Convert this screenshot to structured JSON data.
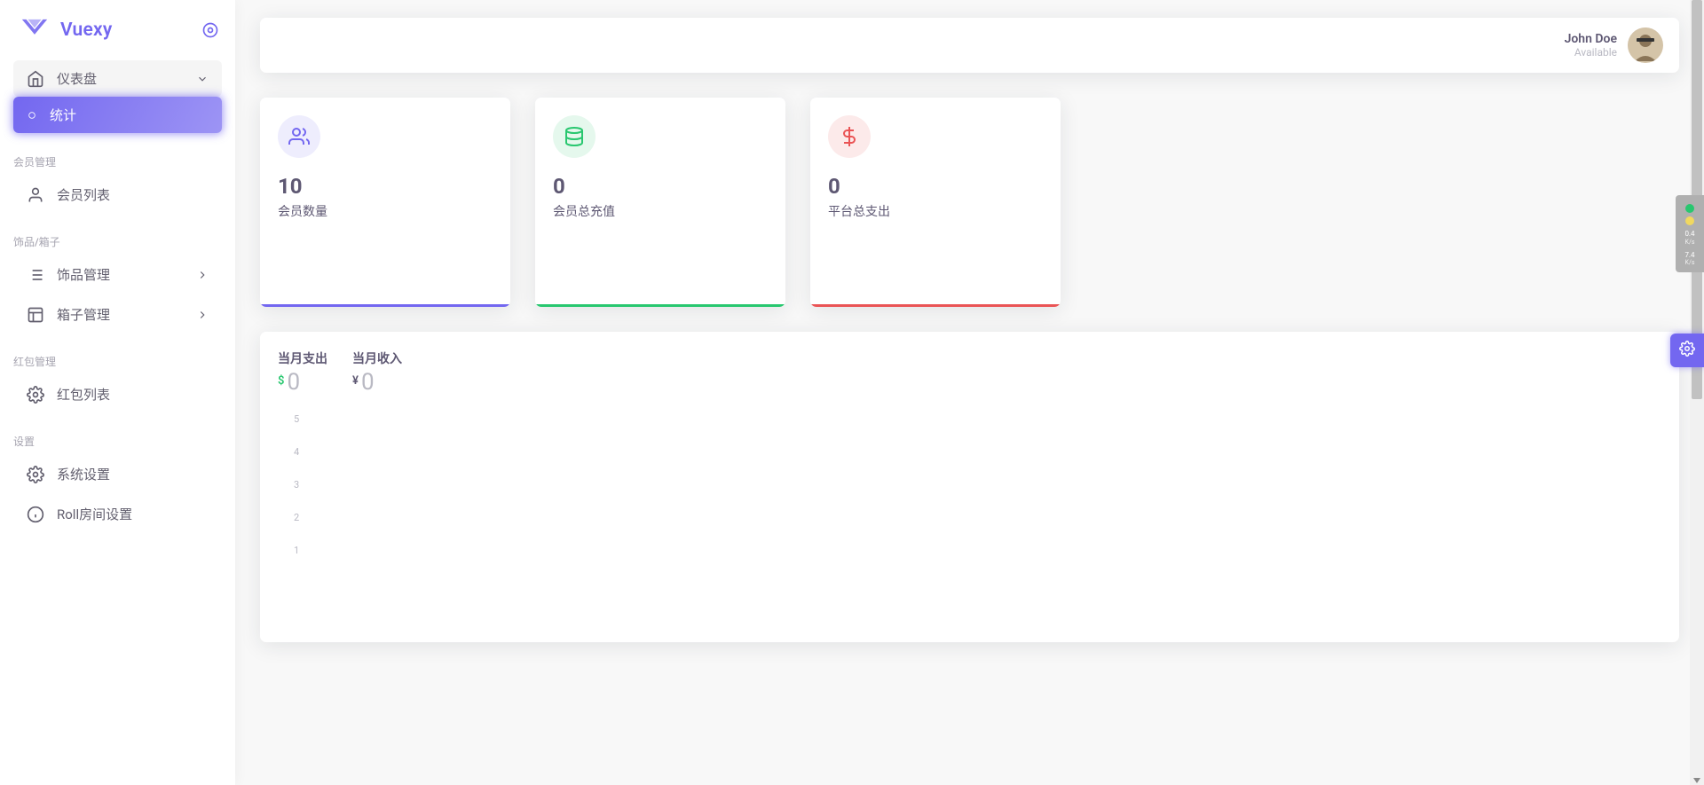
{
  "brand": {
    "name": "Vuexy"
  },
  "user": {
    "name": "John Doe",
    "status": "Available"
  },
  "sidebar": {
    "dashboard": {
      "label": "仪表盘"
    },
    "stats": {
      "label": "统计"
    },
    "sections": {
      "members": "会员管理",
      "items": "饰品/箱子",
      "redpacket": "红包管理",
      "settings": "设置"
    },
    "memberList": "会员列表",
    "itemManage": "饰品管理",
    "boxManage": "箱子管理",
    "redpacketList": "红包列表",
    "systemSettings": "系统设置",
    "rollRoomSettings": "Roll房间设置"
  },
  "stats": {
    "members": {
      "value": "10",
      "label": "会员数量"
    },
    "recharge": {
      "value": "0",
      "label": "会员总充值"
    },
    "payout": {
      "value": "0",
      "label": "平台总支出"
    }
  },
  "revenue": {
    "expenseTitle": "当月支出",
    "incomeTitle": "当月收入",
    "expenseValue": "0",
    "incomeValue": "0",
    "expenseCurrency": "$",
    "incomeCurrency": "¥"
  },
  "chart_data": {
    "type": "line",
    "title": "",
    "xlabel": "",
    "ylabel": "",
    "ylim": [
      0,
      5
    ],
    "y_ticks": [
      5,
      4,
      3,
      2,
      1
    ],
    "series": [
      {
        "name": "当月支出",
        "values": []
      },
      {
        "name": "当月收入",
        "values": []
      }
    ],
    "categories": []
  },
  "network": {
    "down": {
      "value": "0.4",
      "unit": "K/s"
    },
    "up": {
      "value": "7.4",
      "unit": "K/s"
    }
  }
}
